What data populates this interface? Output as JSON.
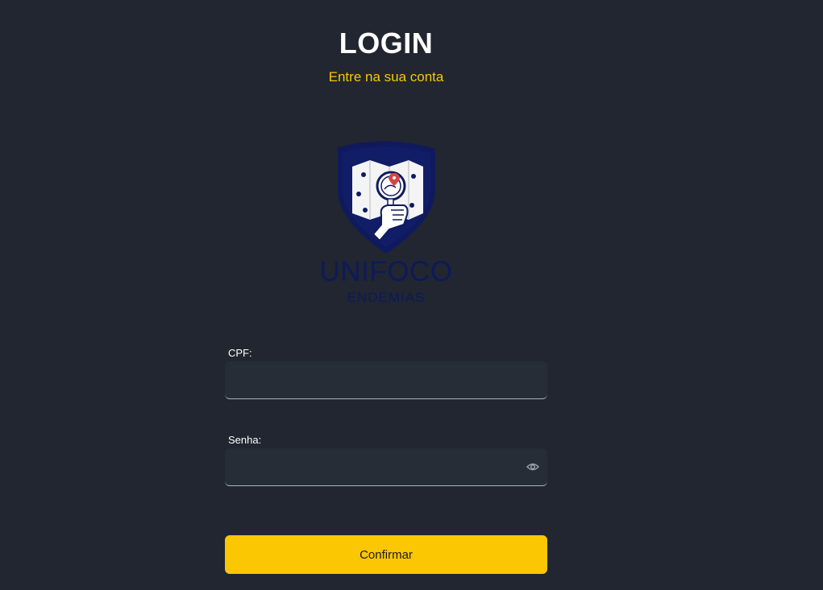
{
  "header": {
    "title": "LOGIN",
    "subtitle": "Entre na sua conta"
  },
  "logo": {
    "name": "UNIFOCO",
    "tagline": "ENDEMIAS",
    "icon": "shield-map-magnifier-icon"
  },
  "form": {
    "cpf": {
      "label": "CPF:",
      "value": "",
      "placeholder": ""
    },
    "senha": {
      "label": "Senha:",
      "value": "",
      "placeholder": "",
      "toggle_icon": "eye-icon"
    },
    "submit_label": "Confirmar"
  },
  "colors": {
    "background": "#212630",
    "accent": "#fbc602",
    "input_bg": "#272d37",
    "logo_navy": "#0d1a5a"
  }
}
